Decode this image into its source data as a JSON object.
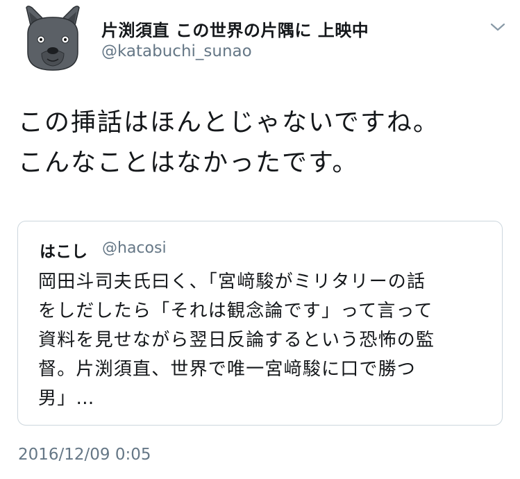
{
  "author": {
    "display_name": "片渕須直 この世界の片隅に 上映中",
    "handle": "@katabuchi_sunao",
    "avatar_icon": "french-bulldog-avatar-icon"
  },
  "menu": {
    "icon": "chevron-down-icon"
  },
  "tweet": {
    "text_lines": [
      "この挿話はほんとじゃないですね。",
      "こんなことはなかったです。"
    ]
  },
  "quoted_tweet": {
    "display_name": "はこし",
    "handle": "@hacosi",
    "text_lines": [
      "岡田斗司夫氏曰く、「宮﨑駿がミリタリーの話",
      "をしだしたら「それは観念論です」って言って",
      "資料を見せながら翌日反論するという恐怖の監",
      "督。片渕須直、世界で唯一宮﨑駿に口で勝つ",
      "男」…"
    ]
  },
  "timestamp": "2016/12/09 0:05",
  "colors": {
    "text": "#14171a",
    "secondary": "#657786",
    "border": "#ccd6dd",
    "avatar_body": "#5b6066"
  }
}
